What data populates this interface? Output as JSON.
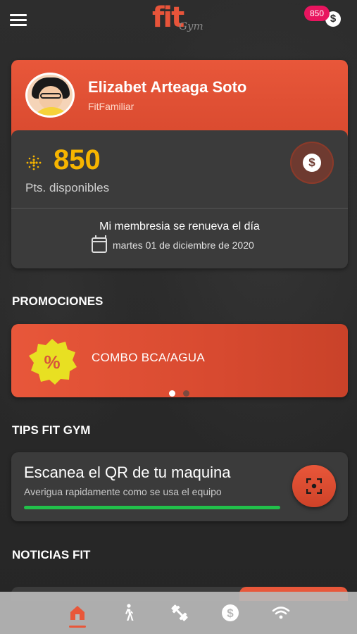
{
  "header": {
    "logo_main": "fit",
    "logo_sub": "Gym",
    "points_badge": "850",
    "coin_symbol": "$"
  },
  "profile": {
    "name": "Elizabet Arteaga Soto",
    "plan": "FitFamiliar"
  },
  "points": {
    "value": "850",
    "label": "Pts. disponibles",
    "coin_symbol": "$"
  },
  "membership": {
    "renew_text": "Mi membresia se renueva el día",
    "renew_date": "martes 01 de diciembre de 2020"
  },
  "promotions": {
    "title": "PROMOCIONES",
    "items": [
      {
        "name": "COMBO BCA/AGUA",
        "badge_symbol": "%"
      }
    ],
    "carousel_active_index": 0,
    "carousel_count": 2
  },
  "tips": {
    "title": "TIPS FIT GYM",
    "card_title": "Escanea el QR de tu maquina",
    "card_subtitle": "Averigua rapidamente como se usa el equipo"
  },
  "news": {
    "title": "NOTICIAS FIT"
  },
  "nav": {
    "items": [
      {
        "icon": "home-icon",
        "active": true
      },
      {
        "icon": "walking-icon",
        "active": false
      },
      {
        "icon": "dumbbell-icon",
        "active": false
      },
      {
        "icon": "dollar-coin-icon",
        "active": false
      },
      {
        "icon": "wifi-icon",
        "active": false
      }
    ]
  },
  "colors": {
    "accent": "#e8573a",
    "points_gold": "#f7b500",
    "badge_pink": "#e8155f",
    "progress_green": "#21c04a",
    "background": "#2a2a2a",
    "card": "#3b3b3b"
  }
}
